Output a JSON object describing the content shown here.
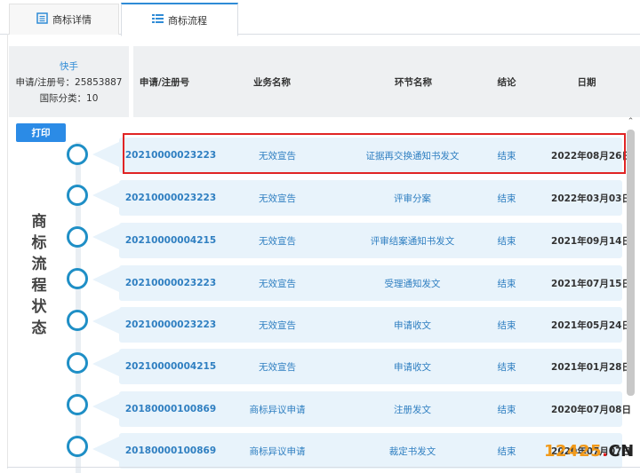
{
  "tabs": {
    "detail_label": "商标详情",
    "flow_label": "商标流程"
  },
  "info": {
    "owner": "快手",
    "reg_no": "申请/注册号：25853887",
    "class": "国际分类：10"
  },
  "table": {
    "headers": [
      "申请/注册号",
      "业务名称",
      "环节名称",
      "结论",
      "日期"
    ],
    "rows": [
      {
        "no": "20210000023223",
        "biz": "无效宣告",
        "step": "证据再交换通知书发文",
        "result": "结束",
        "date": "2022年08月26日"
      },
      {
        "no": "20210000023223",
        "biz": "无效宣告",
        "step": "评审分案",
        "result": "结束",
        "date": "2022年03月03日"
      },
      {
        "no": "20210000004215",
        "biz": "无效宣告",
        "step": "评审结案通知书发文",
        "result": "结束",
        "date": "2021年09月14日"
      },
      {
        "no": "20210000023223",
        "biz": "无效宣告",
        "step": "受理通知发文",
        "result": "结束",
        "date": "2021年07月15日"
      },
      {
        "no": "20210000023223",
        "biz": "无效宣告",
        "step": "申请收文",
        "result": "结束",
        "date": "2021年05月24日"
      },
      {
        "no": "20210000004215",
        "biz": "无效宣告",
        "step": "申请收文",
        "result": "结束",
        "date": "2021年01月28日"
      },
      {
        "no": "20180000100869",
        "biz": "商标异议申请",
        "step": "注册发文",
        "result": "结束",
        "date": "2020年07月08日"
      },
      {
        "no": "20180000100869",
        "biz": "商标异议申请",
        "step": "裁定书发文",
        "result": "结束",
        "date": "2020年07月07日"
      }
    ]
  },
  "print_label": "打印",
  "side_title": [
    "商",
    "标",
    "流",
    "程",
    "状",
    "态"
  ],
  "watermark": {
    "num": "12425",
    "dot": ".",
    "cn": "CN"
  },
  "colors": {
    "accent": "#2b8be6",
    "circle": "#1f8fc6",
    "card": "#e8f3fb",
    "highlight": "#e02424"
  }
}
